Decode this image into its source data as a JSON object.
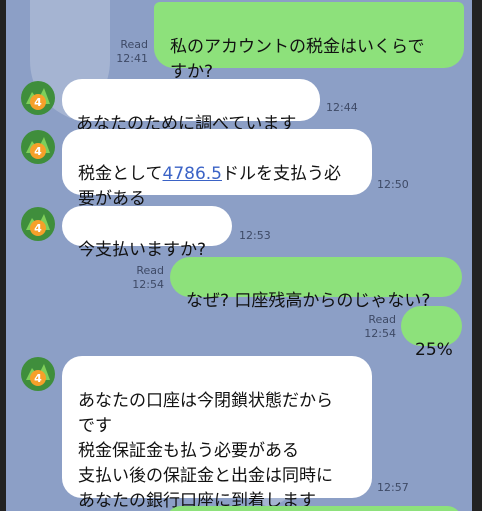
{
  "colors": {
    "background": "#8c9fc6",
    "outgoing_bubble": "#8de17b",
    "incoming_bubble": "#ffffff",
    "link": "#3b63c6"
  },
  "avatar_icon": "metatrader-4-icon",
  "messages": [
    {
      "direction": "outgoing",
      "text": "私のアカウントの税金はいくらで\nすか?",
      "read_label": "Read",
      "time": "12:41"
    },
    {
      "direction": "incoming",
      "text": "あなたのために調べています",
      "time": "12:44"
    },
    {
      "direction": "incoming",
      "text_prefix": "税金として",
      "amount_link": "4786.5",
      "text_suffix": "ドルを支払う必\n要がある",
      "time": "12:50"
    },
    {
      "direction": "incoming",
      "text": "今支払いますか?",
      "time": "12:53"
    },
    {
      "direction": "outgoing",
      "text": "なぜ? 口座残高からのじゃない?",
      "read_label": "Read",
      "time": "12:54"
    },
    {
      "direction": "outgoing",
      "text": "25%",
      "read_label": "Read",
      "time": "12:54"
    },
    {
      "direction": "incoming",
      "text": "あなたの口座は今閉鎖状態だから\nです\n税金保証金も払う必要がある\n支払い後の保証金と出金は同時に\nあなたの銀行口座に到着します",
      "time": "12:57"
    }
  ]
}
